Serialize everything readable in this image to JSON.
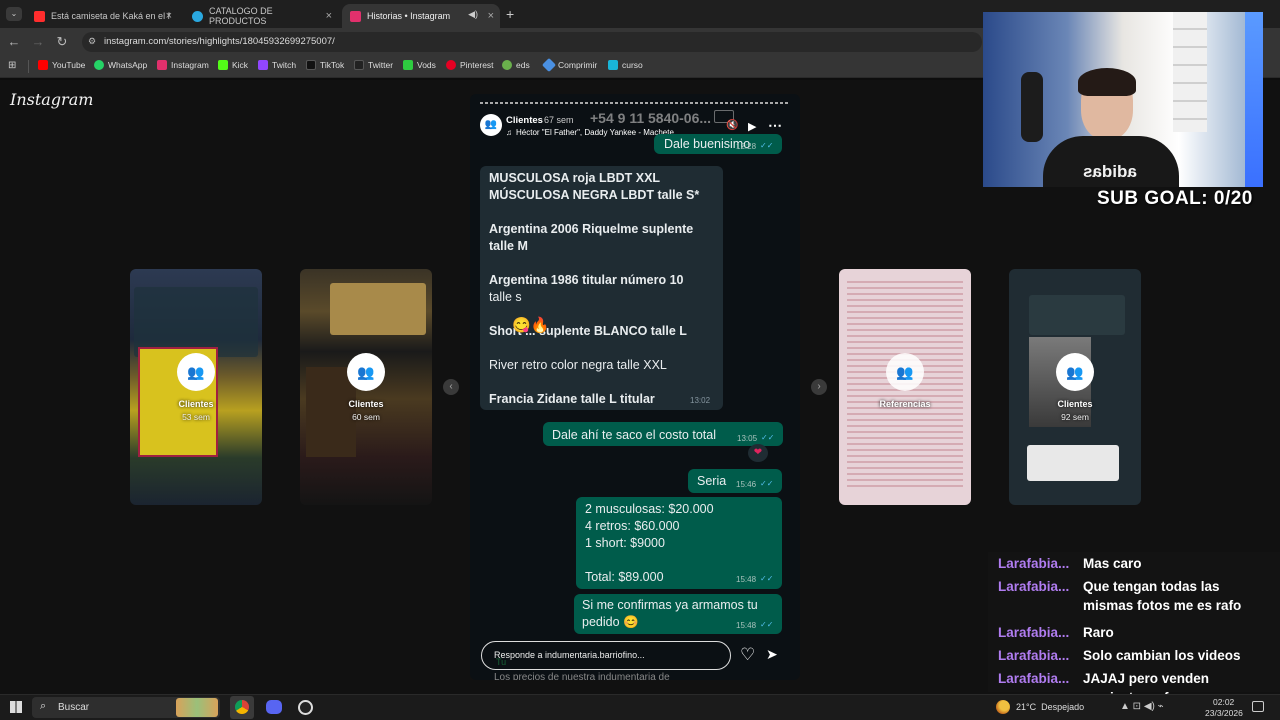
{
  "browser": {
    "tabs": [
      {
        "title": "Está camiseta de Kaká en el Mi",
        "favicon_color": "#ff2d2d"
      },
      {
        "title": "CATALOGO DE PRODUCTOS",
        "favicon_color": "#2aa8e0"
      },
      {
        "title": "Historias • Instagram",
        "favicon_color": "#e1306c"
      }
    ],
    "new_tab": "+",
    "url": "instagram.com/stories/highlights/18045932699275007/",
    "bookmarks": [
      {
        "label": "YouTube",
        "color": "#ff0000"
      },
      {
        "label": "WhatsApp",
        "color": "#25d366"
      },
      {
        "label": "Instagram",
        "color": "#e1306c"
      },
      {
        "label": "Kick",
        "color": "#53fc18"
      },
      {
        "label": "Twitch",
        "color": "#9146ff"
      },
      {
        "label": "TikTok",
        "color": "#111111"
      },
      {
        "label": "Twitter",
        "color": "#222222"
      },
      {
        "label": "Vods",
        "color": "#2ecc40"
      },
      {
        "label": "Pinterest",
        "color": "#e60023"
      },
      {
        "label": "eds",
        "color": "#6ab04c"
      },
      {
        "label": "Comprimir",
        "color": "#4a90e2"
      },
      {
        "label": "curso",
        "color": "#19b5d8"
      }
    ]
  },
  "instagram": {
    "logo": "Instagram",
    "highlights": [
      {
        "name": "Clientes",
        "time": "53 sem"
      },
      {
        "name": "Clientes",
        "time": "60 sem"
      },
      {
        "name": "Referencias",
        "time": ""
      },
      {
        "name": "Clientes",
        "time": "92 sem"
      }
    ],
    "story": {
      "title": "Clientes",
      "time": "67 sem",
      "song": "Héctor \"El Father\", Daddy Yankee - Machete",
      "phone": "+54 9 11 5840-06...",
      "messages": [
        {
          "dir": "out",
          "text": "Dale buenisimo",
          "time": "12:28"
        },
        {
          "dir": "in",
          "lines": [
            "MUSCULOSA roja LBDT XXL",
            "MÚSCULOSA NEGRA LBDT talle S*",
            "",
            "Argentina 2006 Riquelme suplente",
            "talle M",
            "",
            "Argentina 1986 titular número 10",
            "talle s",
            "",
            "Short ... suplente BLANCO talle L",
            "",
            "River retro color negra talle XXL",
            "",
            "Francia Zidane talle L titular"
          ],
          "time": "13:02"
        },
        {
          "dir": "out",
          "text": "Dale ahí te saco el costo total",
          "time": "13:05"
        },
        {
          "dir": "out",
          "text": "Seria",
          "time": "15:46"
        },
        {
          "dir": "out",
          "lines": [
            "2 musculosas: $20.000",
            "4 retros: $60.000",
            "1 short: $9000",
            "",
            "Total: $89.000"
          ],
          "time": "15:48"
        },
        {
          "dir": "out",
          "lines": [
            "Si me confirmas ya armamos tu",
            "pedido 😊"
          ],
          "time": "15:48"
        }
      ],
      "reply_placeholder": "Responde a indumentaria.barriofino...",
      "footer_label": "Tu",
      "footer_text": "Los precios de nuestra indumentaria de"
    }
  },
  "stream": {
    "sub_goal": "SUB GOAL: 0/20",
    "shirt_text": "adidas",
    "chat": [
      {
        "user": "Larafabia...",
        "text": "Mas caro"
      },
      {
        "user": "Larafabia...",
        "text": "Que tengan todas las mismas fotos me es rafo"
      },
      {
        "user": "Larafabia...",
        "text": "Raro"
      },
      {
        "user": "Larafabia...",
        "text": "Solo cambian los videos"
      },
      {
        "user": "Larafabia...",
        "text": "JAJAJ pero venden camisetas o free"
      }
    ]
  },
  "taskbar": {
    "search": "Buscar",
    "weather": "21°C  Despejado",
    "time": "02:02",
    "date": "23/3/2026"
  }
}
